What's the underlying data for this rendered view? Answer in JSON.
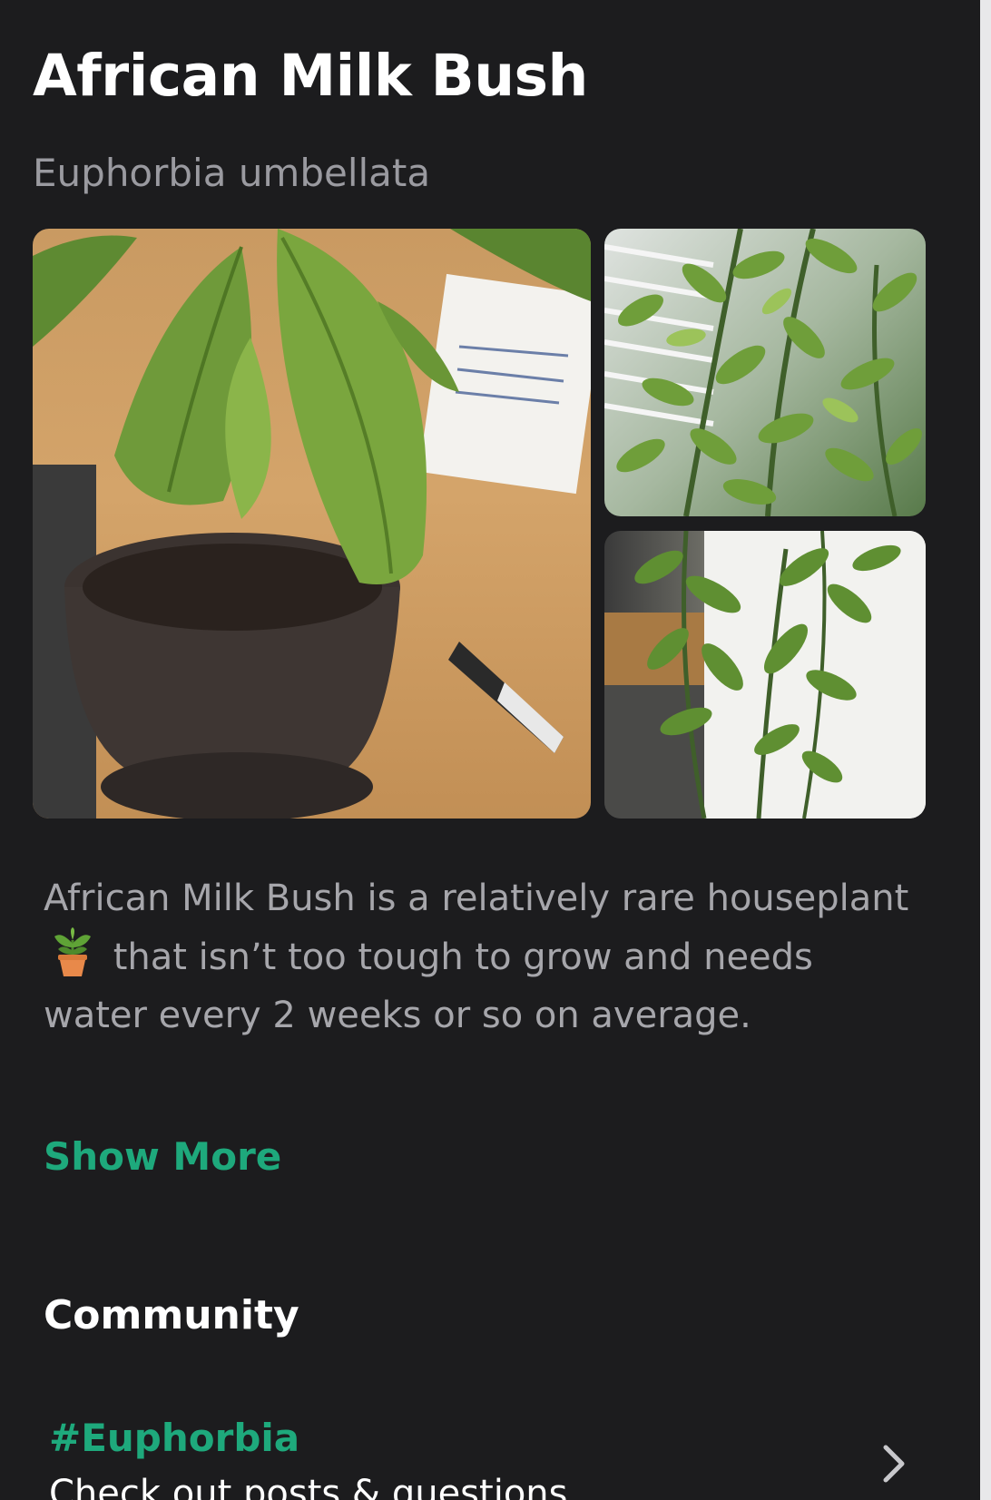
{
  "plant": {
    "common_name": "African Milk Bush",
    "scientific_name": "Euphorbia umbellata"
  },
  "gallery": {
    "photos": [
      {
        "name": "potted-plant-photo"
      },
      {
        "name": "plant-by-window-photo"
      },
      {
        "name": "plant-trailing-photo"
      }
    ],
    "badge_icon": "image-gallery-icon"
  },
  "description": {
    "text_before_icon": "African Milk Bush is a relatively rare houseplant",
    "inline_icon": "potted-plant-emoji-icon",
    "text_after_icon": "that isn’t too tough to grow and needs water every 2 weeks or so on average.",
    "show_more_label": "Show More"
  },
  "community": {
    "heading": "Community",
    "row": {
      "hashtag": "#Euphorbia",
      "subtitle": "Check out posts & questions",
      "icon": "chevron-right-icon"
    }
  },
  "colors": {
    "background": "#1c1c1e",
    "accent": "#1ea97c",
    "secondary_text": "#a6a6ab"
  }
}
